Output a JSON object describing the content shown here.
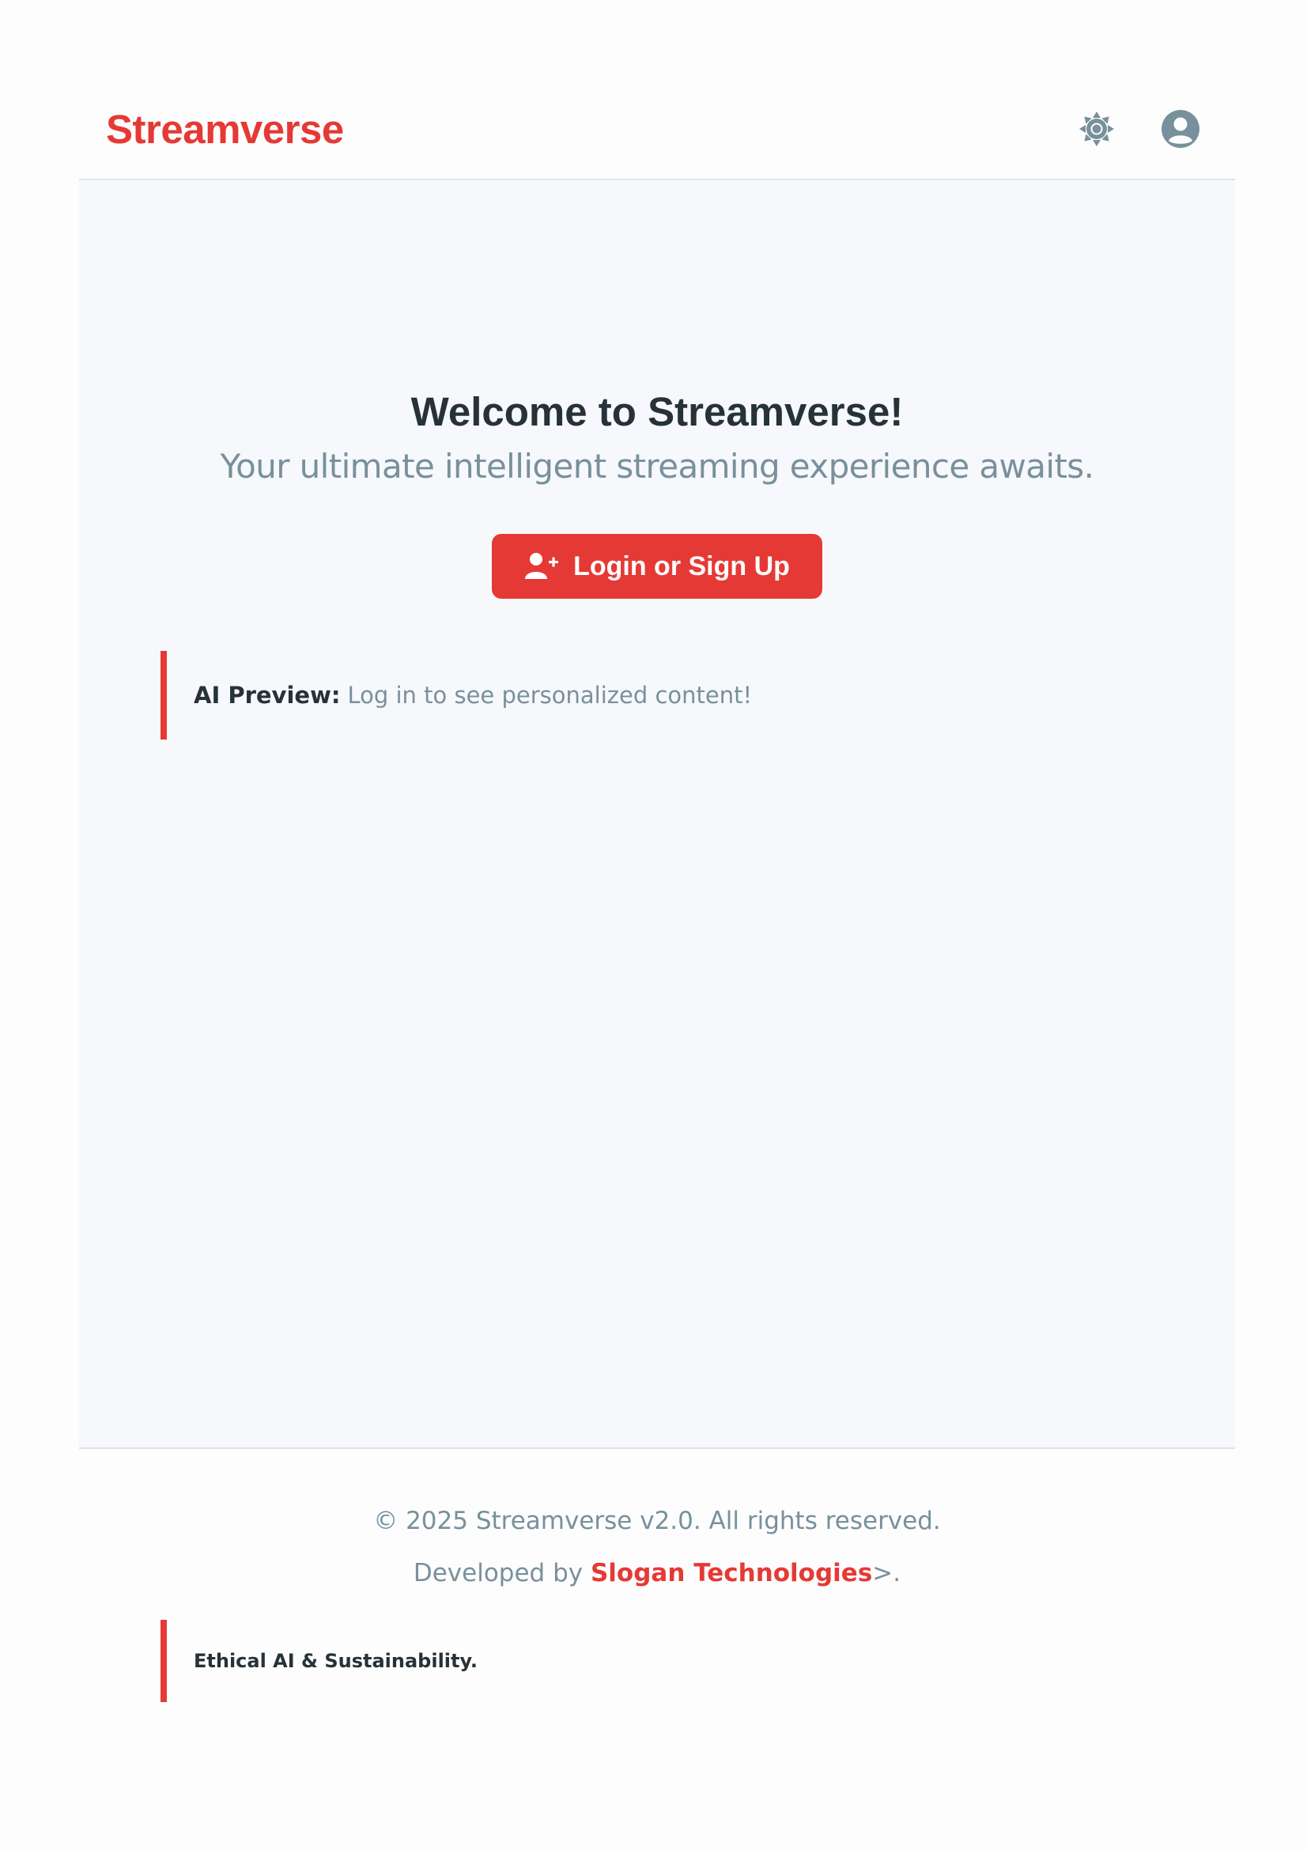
{
  "header": {
    "logo": "Streamverse",
    "theme_icon": "sun-icon",
    "account_icon": "user-circle-icon"
  },
  "hero": {
    "title": "Welcome to Streamverse!",
    "subtitle": "Your ultimate intelligent streaming experience awaits.",
    "login_button_label": "Login or Sign Up",
    "login_button_icon": "user-plus-icon"
  },
  "ai_preview": {
    "label": "AI Preview:",
    "text": "Log in to see personalized content!"
  },
  "footer": {
    "copyright": "© 2025 Streamverse v2.0. All rights reserved.",
    "developed_prefix": "Developed by ",
    "developer_name": "Slogan Technologies",
    "developed_suffix": ">.",
    "ethics": "Ethical AI & Sustainability."
  },
  "colors": {
    "accent": "#e53935",
    "text_dark": "#263238",
    "text_muted": "#78909c",
    "main_bg": "#f6f8fb"
  }
}
